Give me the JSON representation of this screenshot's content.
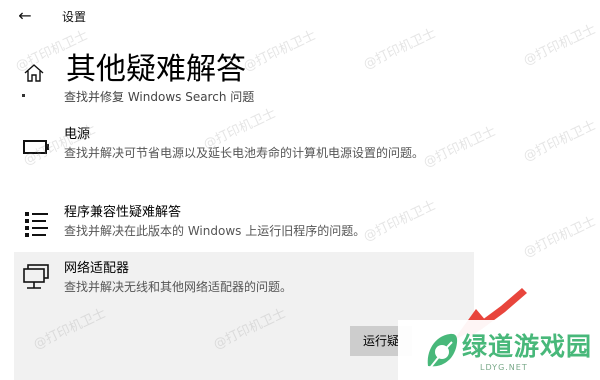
{
  "window": {
    "title": "设置"
  },
  "page": {
    "title": "其他疑难解答"
  },
  "cut_item": {
    "text": "查找并修复 Windows Search 问题"
  },
  "items": [
    {
      "title": "电源",
      "description": "查找并解决可节省电源以及延长电池寿命的计算机电源设置的问题。",
      "icon": "battery-icon"
    },
    {
      "title": "程序兼容性疑难解答",
      "description": "查找并解决在此版本的 Windows 上运行旧程序的问题。",
      "icon": "list-icon"
    },
    {
      "title": "网络适配器",
      "description": "查找并解决无线和其他网络适配器的问题。",
      "icon": "network-adapter-icon",
      "button": "运行疑难解答程序",
      "button_visible": "运行疑"
    }
  ],
  "watermark": {
    "text": "@打印机卫士"
  },
  "logo": {
    "text": "绿道游戏园",
    "sub": "LDYG.NET"
  },
  "colors": {
    "selected_bg": "#f1f1f1",
    "button_bg": "#cdcdcd",
    "arrow": "#e8453c",
    "logo_green": "#48b87a"
  }
}
